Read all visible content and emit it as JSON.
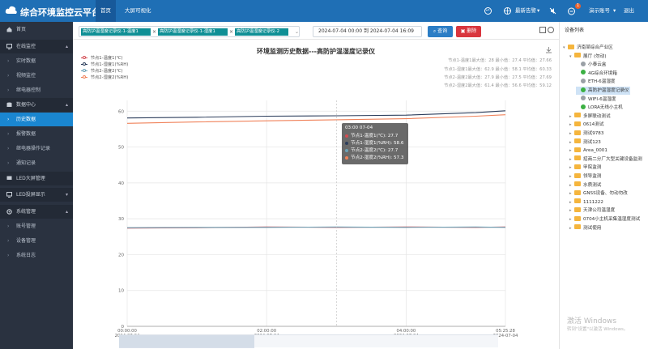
{
  "header": {
    "title": "综合环境监控云平台",
    "nav": [
      {
        "label": "首页"
      },
      {
        "label": "大屏可视化"
      }
    ],
    "notice": "最新告警",
    "account": "演示账号",
    "badge_count": "1",
    "logout": "退出"
  },
  "sidebar": {
    "items": [
      {
        "label": "首页"
      },
      {
        "label": "在线监控"
      },
      {
        "label": "实时数据"
      },
      {
        "label": "视频监控"
      },
      {
        "label": "继电器控制"
      },
      {
        "label": "数据中心"
      },
      {
        "label": "历史数据"
      },
      {
        "label": "报警数据"
      },
      {
        "label": "继电器操作记录"
      },
      {
        "label": "通知记录"
      },
      {
        "label": "LED大屏管理"
      },
      {
        "label": "LED投屏显示"
      },
      {
        "label": "系统管理"
      },
      {
        "label": "账号管理"
      },
      {
        "label": "设备管理"
      },
      {
        "label": "系统日志"
      }
    ]
  },
  "filter": {
    "tags": [
      "高防护温湿度记录仪-1-温度1",
      "高防护温湿度记录仪-1-湿度1",
      "高防护温湿度记录仪-2"
    ],
    "date_range": "2024-07-04 00:00 到 2024-07-04 16:09",
    "query_label": "查询",
    "delete_label": "删除"
  },
  "chart_data": {
    "type": "line",
    "title": "环境监测历史数据---高防护温湿度记录仪",
    "x_ticks": [
      {
        "time": "00:00:00",
        "date": "2024-07-04"
      },
      {
        "time": "02:00:00",
        "date": "2024-07-04"
      },
      {
        "time": "04:00:00",
        "date": "2024-07-04"
      },
      {
        "time": "05:25:28",
        "date": "2024-07-04"
      }
    ],
    "x_range_hours": [
      0,
      5.4244
    ],
    "y_ticks": [
      0,
      10,
      20,
      30,
      40,
      50,
      60
    ],
    "ylim": [
      0,
      63
    ],
    "grid": true,
    "legend_position": "top-left",
    "series": [
      {
        "name": "节点1-温度1(℃)",
        "color": "#d44c53",
        "values": [
          [
            0,
            27.4
          ],
          [
            1,
            27.5
          ],
          [
            2,
            27.7
          ],
          [
            3,
            27.6
          ],
          [
            4,
            27.7
          ],
          [
            5,
            27.6
          ],
          [
            5.4244,
            27.7
          ]
        ]
      },
      {
        "name": "节点1-湿度1(%RH)",
        "color": "#2d3e5c",
        "values": [
          [
            0,
            58.1
          ],
          [
            1,
            58.3
          ],
          [
            2,
            58.6
          ],
          [
            3,
            58.7
          ],
          [
            4,
            58.9
          ],
          [
            5,
            59.6
          ],
          [
            5.4244,
            60.1
          ]
        ]
      },
      {
        "name": "节点2-温度2(℃)",
        "color": "#6aa2b6",
        "values": [
          [
            0,
            27.5
          ],
          [
            1,
            27.6
          ],
          [
            2,
            27.6
          ],
          [
            3,
            27.7
          ],
          [
            4,
            27.6
          ],
          [
            5,
            27.7
          ],
          [
            5.4244,
            27.6
          ]
        ]
      },
      {
        "name": "节点2-湿度2(%RH)",
        "color": "#f0825a",
        "values": [
          [
            0,
            56.6
          ],
          [
            1,
            57.0
          ],
          [
            2,
            57.3
          ],
          [
            3,
            57.6
          ],
          [
            4,
            57.9
          ],
          [
            5,
            58.6
          ],
          [
            5.4244,
            59.0
          ]
        ]
      }
    ],
    "stats": [
      "节点1-温度1最大值：28  最小值：27.4  平均值：27.66",
      "节点1-湿度1最大值：62.9  最小值：58.1  平均值：60.33",
      "节点2-温度2最大值：27.9  最小值：27.5  平均值：27.69",
      "节点2-湿度2最大值：61.4  最小值：56.6  平均值：59.12"
    ],
    "tooltip": {
      "time": "03:00 07-04",
      "rows": [
        "节点1-温度1(℃): 27.7",
        "节点1-湿度1(%RH): 58.6",
        "节点2-温度2(℃): 27.7",
        "节点2-湿度2(%RH): 57.3"
      ]
    }
  },
  "device_panel": {
    "title": "设备列表",
    "tree": [
      {
        "label": "济南某综合产业区",
        "icon": "folder",
        "indent": 0
      },
      {
        "label": "展厅 (勿动)",
        "icon": "folder",
        "indent": 1
      },
      {
        "label": "小泰云盒",
        "icon": "device-off",
        "indent": 2
      },
      {
        "label": "4G综合环境箱",
        "icon": "device-on",
        "indent": 2
      },
      {
        "label": "ETH-6温湿度",
        "icon": "device-off",
        "indent": 2
      },
      {
        "label": "高防护温湿度记录仪",
        "icon": "device-on",
        "indent": 2,
        "selected": true
      },
      {
        "label": "WIFI-6温湿度",
        "icon": "device-off",
        "indent": 2
      },
      {
        "label": "LORA无线小主机",
        "icon": "device-on",
        "indent": 2
      },
      {
        "label": "多屏联动测试",
        "icon": "folder",
        "indent": 1
      },
      {
        "label": "0614测试",
        "icon": "folder",
        "indent": 1
      },
      {
        "label": "测试9783",
        "icon": "folder",
        "indent": 1
      },
      {
        "label": "测试123",
        "icon": "folder",
        "indent": 1
      },
      {
        "label": "Area_0001",
        "icon": "folder",
        "indent": 1
      },
      {
        "label": "招商二分厂大型关键设备监测",
        "icon": "folder",
        "indent": 1
      },
      {
        "label": "甲院监测",
        "icon": "folder",
        "indent": 1
      },
      {
        "label": "领导监测",
        "icon": "folder",
        "indent": 1
      },
      {
        "label": "水质测试",
        "icon": "folder",
        "indent": 1
      },
      {
        "label": "GNSS设备、勿动勿改",
        "icon": "folder",
        "indent": 1
      },
      {
        "label": "1111222",
        "icon": "folder",
        "indent": 1
      },
      {
        "label": "天津公司温湿度",
        "icon": "folder",
        "indent": 1
      },
      {
        "label": "0704小主机采集温湿度测试",
        "icon": "folder",
        "indent": 1
      },
      {
        "label": "测试使用",
        "icon": "folder",
        "indent": 1
      }
    ]
  },
  "watermark": {
    "line1": "激活 Windows",
    "line2": "转到\"设置\"以激活 Windows。"
  },
  "colors": {
    "topbar": "#1f6fb5",
    "sidebar": "#2a3240",
    "active": "#1a86d0",
    "tag": "#0f8f95"
  }
}
